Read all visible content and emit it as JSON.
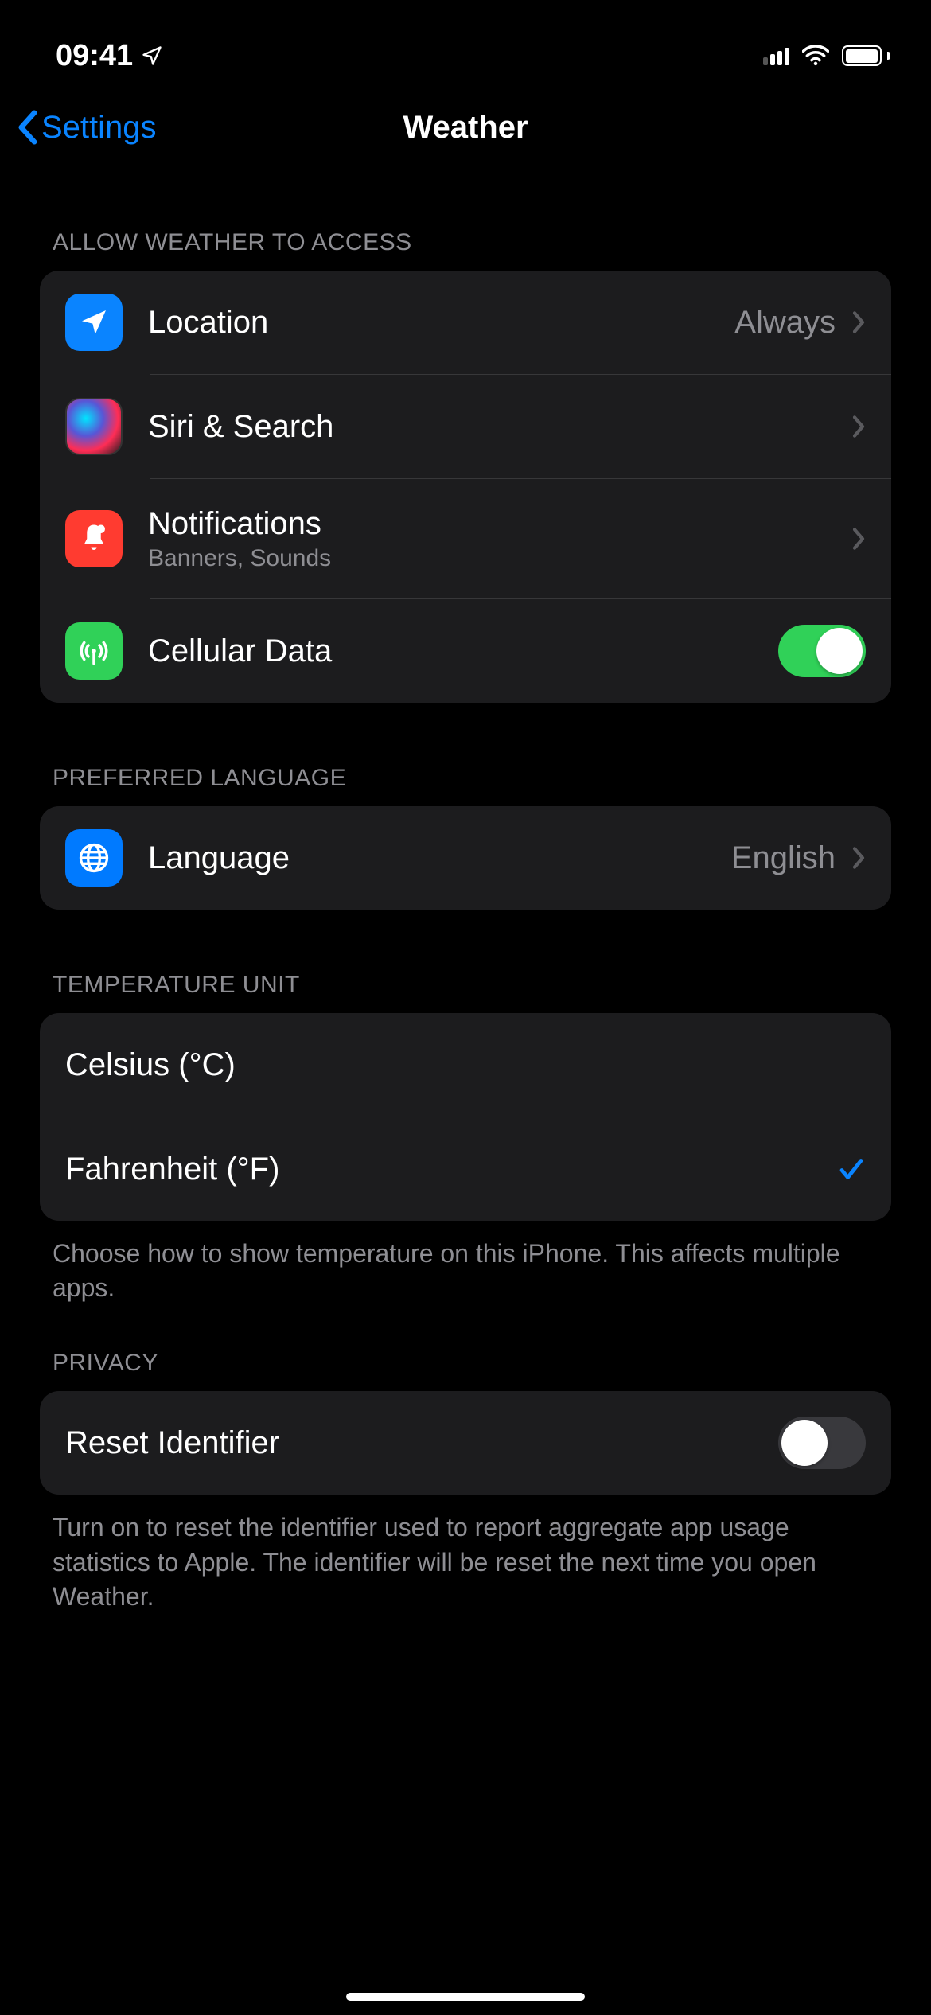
{
  "status": {
    "time": "09:41"
  },
  "nav": {
    "back": "Settings",
    "title": "Weather"
  },
  "sections": {
    "access": {
      "header": "ALLOW WEATHER TO ACCESS",
      "location": {
        "label": "Location",
        "value": "Always"
      },
      "siri": {
        "label": "Siri & Search"
      },
      "notifications": {
        "label": "Notifications",
        "sub": "Banners, Sounds"
      },
      "cellular": {
        "label": "Cellular Data",
        "on": true
      }
    },
    "language": {
      "header": "PREFERRED LANGUAGE",
      "row": {
        "label": "Language",
        "value": "English"
      }
    },
    "temp": {
      "header": "TEMPERATURE UNIT",
      "celsius": {
        "label": "Celsius (°C)",
        "selected": false
      },
      "fahrenheit": {
        "label": "Fahrenheit (°F)",
        "selected": true
      },
      "footer": "Choose how to show temperature on this iPhone. This affects multiple apps."
    },
    "privacy": {
      "header": "PRIVACY",
      "reset": {
        "label": "Reset Identifier",
        "on": false
      },
      "footer": "Turn on to reset the identifier used to report aggregate app usage statistics to Apple. The identifier will be reset the next time you open Weather."
    }
  }
}
